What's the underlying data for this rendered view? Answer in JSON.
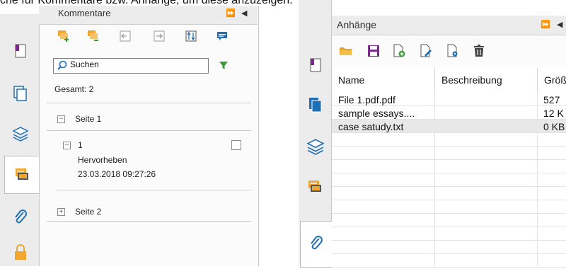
{
  "caption_fragment": "che für Kommentare bzw. Anhänge, um diese anzuzeigen.",
  "left_panel": {
    "title": "Kommentare",
    "controls": {
      "expand": "⏩",
      "collapse": "◀"
    },
    "search": {
      "label": "Suchen"
    },
    "total_label": "Gesamt: 2",
    "pages": [
      {
        "label": "Seite 1",
        "expander": "−",
        "comments": [
          {
            "number": "1",
            "type": "Hervorheben",
            "timestamp": "23.03.2018 09:27:26",
            "expander": "−"
          }
        ]
      },
      {
        "label": "Seite 2",
        "expander": "+"
      }
    ],
    "sidebar_tabs": [
      "bookmark-icon",
      "pages-icon",
      "layers-icon",
      "comment-icon",
      "attachment-icon",
      "lock-icon"
    ],
    "toolbar_icons": [
      "add-comment-icon",
      "remove-comment-icon",
      "collapse-icon",
      "expand-icon",
      "sort-icon",
      "note-icon"
    ]
  },
  "right_panel": {
    "title": "Anhänge",
    "controls": {
      "expand": "⏩",
      "collapse": "◀"
    },
    "toolbar_icons": [
      "open-folder-icon",
      "save-icon",
      "add-file-icon",
      "edit-description-icon",
      "settings-file-icon",
      "delete-icon"
    ],
    "sidebar_tabs": [
      "bookmark-icon",
      "pages-icon",
      "layers-icon",
      "comment-icon",
      "attachment-icon"
    ],
    "columns": [
      "Name",
      "Beschreibung",
      "Größe"
    ],
    "rows": [
      {
        "name": "File 1.pdf.pdf",
        "description": "",
        "size": "527"
      },
      {
        "name": "sample essays....",
        "description": "",
        "size": "12 K"
      },
      {
        "name": "case satudy.txt",
        "description": "",
        "size": "0 KB"
      }
    ],
    "selected_row": 2
  },
  "colors": {
    "accent_blue": "#1f6fb5",
    "accent_orange": "#f0a630",
    "accent_green": "#3a9d3a",
    "purple": "#7b2a8c",
    "red": "#c0392b"
  }
}
